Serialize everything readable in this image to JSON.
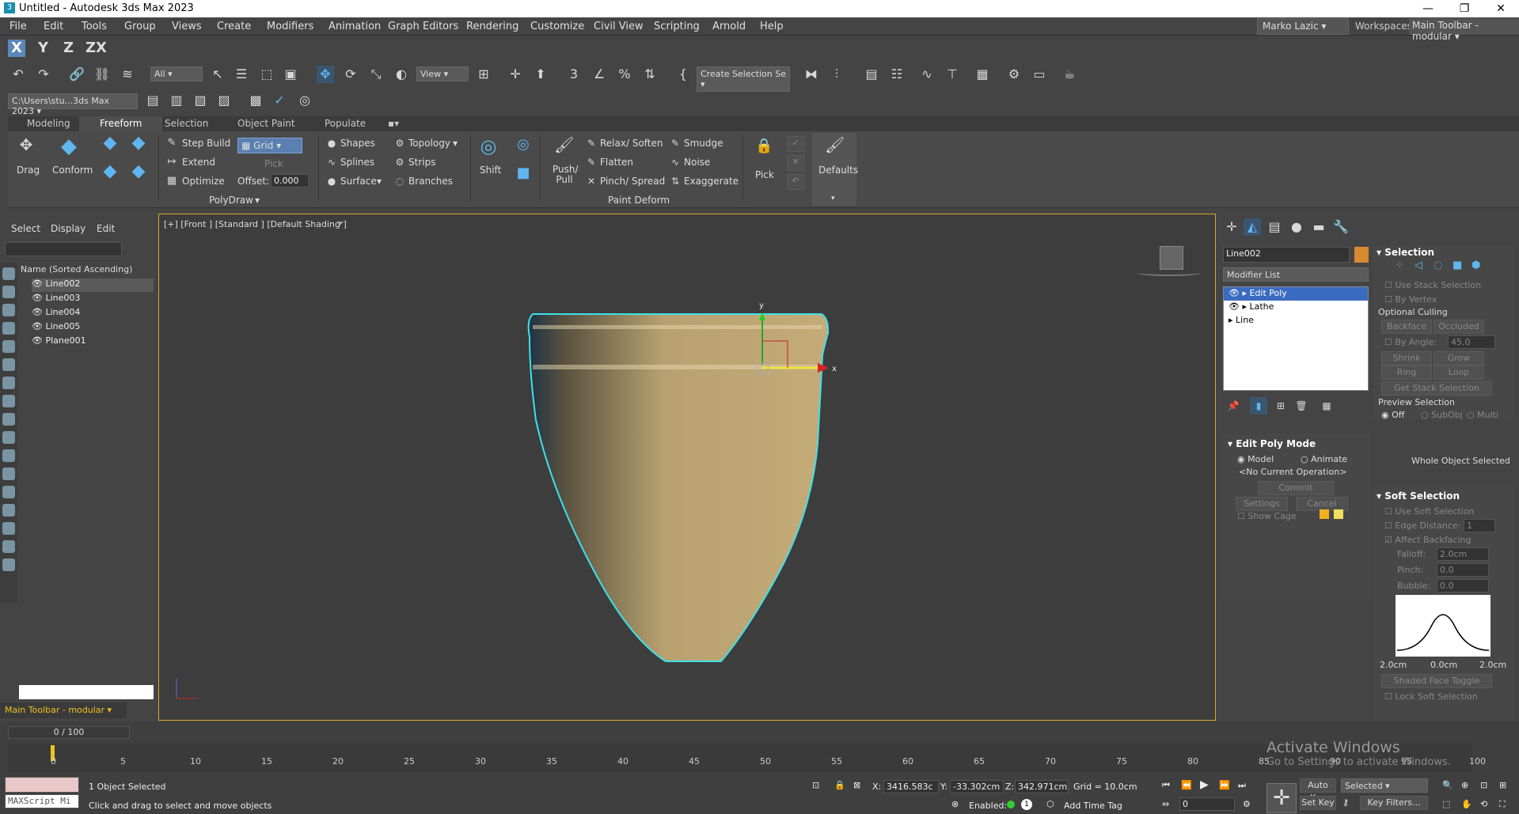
{
  "window": {
    "title": "Untitled - Autodesk 3ds Max 2023",
    "min": "—",
    "max": "❐",
    "close": "✕"
  },
  "menu": [
    "File",
    "Edit",
    "Tools",
    "Group",
    "Views",
    "Create",
    "Modifiers",
    "Animation",
    "Graph Editors",
    "Rendering",
    "Customize",
    "Civil View",
    "Scripting",
    "Arnold",
    "Help"
  ],
  "user": "Marko Lazic",
  "workspace_label": "Workspaces:",
  "workspace": "Main Toolbar - modular",
  "axes": [
    "X",
    "Y",
    "Z",
    "ZX"
  ],
  "toolbar": {
    "filter": "All",
    "refcoord": "View",
    "selset": "Create Selection Se",
    "path": "C:\\Users\\stu...3ds Max 2023"
  },
  "ribbon": {
    "tabs": [
      "Modeling",
      "Freeform",
      "Selection",
      "Object Paint",
      "Populate"
    ],
    "drag": "Drag",
    "conform": "Conform",
    "step_build": "Step Build",
    "extend": "Extend",
    "optimize": "Optimize",
    "grid": "Grid",
    "pick": "Pick",
    "offset_label": "Offset:",
    "offset": "0.000",
    "shapes": "Shapes",
    "splines": "Splines",
    "surface": "Surface",
    "topology": "Topology",
    "strips": "Strips",
    "branches": "Branches",
    "polydraw": "PolyDraw",
    "shift": "Shift",
    "push_pull": "Push/ Pull",
    "relax": "Relax/ Soften",
    "flatten": "Flatten",
    "pinch": "Pinch/ Spread",
    "smudge": "Smudge",
    "noise": "Noise",
    "exaggerate": "Exaggerate",
    "paint_deform": "Paint Deform",
    "pick2": "Pick",
    "defaults": "Defaults"
  },
  "scene": {
    "tabs": [
      "Select",
      "Display",
      "Edit"
    ],
    "header": "Name (Sorted Ascending)",
    "objects": [
      "Line002",
      "Line003",
      "Line004",
      "Line005",
      "Plane001"
    ],
    "toolbar_label": "Main Toolbar - modular"
  },
  "viewport": {
    "label": "[+] [Front ] [Standard ] [Default Shading ]",
    "axis_x": "x",
    "axis_y": "y",
    "colors": {
      "outline": "#3ee0e8",
      "surface": "#b8a170",
      "frame": "#d9a72e"
    }
  },
  "command": {
    "object_name": "Line002",
    "modifier_list": "Modifier List",
    "stack": [
      "Edit Poly",
      "Lathe",
      "Line"
    ],
    "edit_poly_mode": "Edit Poly Mode",
    "model": "Model",
    "animate": "Animate",
    "no_op": "<No Current Operation>",
    "commit": "Commit",
    "settings": "Settings",
    "cancel": "Cancel",
    "show_cage": "Show Cage",
    "selection": "Selection",
    "use_stack": "Use Stack Selection",
    "by_vertex": "By Vertex",
    "optional_culling": "Optional Culling",
    "backface": "Backface",
    "occluded": "Occluded",
    "by_angle": "By Angle:",
    "angle": "45.0",
    "shrink": "Shrink",
    "grow": "Grow",
    "ring": "Ring",
    "loop": "Loop",
    "get_stack": "Get Stack Selection",
    "preview_selection": "Preview Selection",
    "off": "Off",
    "subobj": "SubObj",
    "multi": "Multi",
    "whole_object": "Whole Object Selected",
    "soft_selection": "Soft Selection",
    "use_soft": "Use Soft Selection",
    "edge_distance": "Edge Distance:",
    "edge_val": "1",
    "affect_backfacing": "Affect Backfacing",
    "falloff": "Falloff:",
    "falloff_val": "2.0cm",
    "pinch": "Pinch:",
    "pinch_val": "0.0",
    "bubble": "Bubble:",
    "bubble_val": "0.0",
    "curve_left": "2.0cm",
    "curve_mid": "0.0cm",
    "curve_right": "2.0cm",
    "shaded_face": "Shaded Face Toggle",
    "lock_soft": "Lock Soft Selection"
  },
  "timeline": {
    "frame": "0 / 100",
    "ticks": [
      "0",
      "5",
      "10",
      "15",
      "20",
      "25",
      "30",
      "35",
      "40",
      "45",
      "50",
      "55",
      "60",
      "65",
      "70",
      "75",
      "80",
      "85",
      "90",
      "95",
      "100"
    ]
  },
  "status": {
    "maxscript": "MAXScript Mi",
    "objects_selected": "1 Object Selected",
    "prompt": "Click and drag to select and move objects",
    "x_label": "X:",
    "x": "3416.583c",
    "y_label": "Y:",
    "y": "-33.302cm",
    "z_label": "Z:",
    "z": "342.971cm",
    "grid": "Grid = 10.0cm",
    "enabled": "Enabled:",
    "add_time_tag": "Add Time Tag",
    "auto_key": "Auto Key",
    "selected": "Selected",
    "set_key": "Set Key",
    "key_filters": "Key Filters...",
    "frame": "0",
    "activate_title": "Activate Windows",
    "activate_sub": "Go to Settings to activate Windows."
  }
}
